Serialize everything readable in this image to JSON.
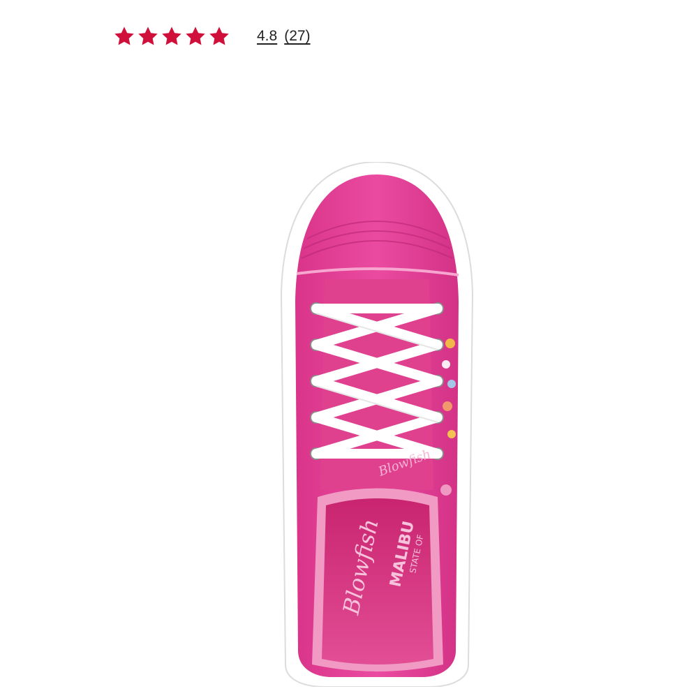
{
  "rating": {
    "stars_filled": 5,
    "stars_total": 5,
    "star_color": "#d0103a",
    "value": "4.8",
    "review_count": "(27)"
  },
  "product_image": {
    "icon": "pink-canvas-sneaker-top-view",
    "upper_color": "#e8439a",
    "sole_color": "#ffffff",
    "lace_color": "#ffffff",
    "insole_brand_text": "Blowfish",
    "insole_sub_text": "MALIBU",
    "insole_small_text": "STATE OF",
    "tongue_brand_text": "Blowfish"
  }
}
